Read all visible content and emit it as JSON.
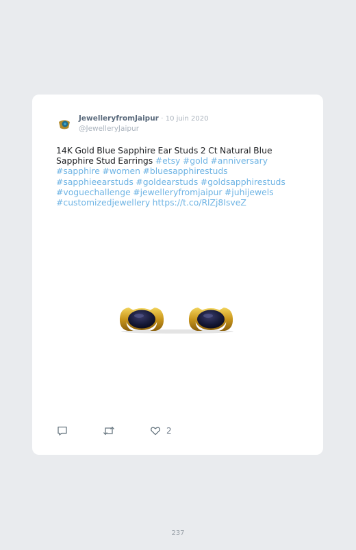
{
  "tweet": {
    "display_name": "JewelleryfromJaipur",
    "separator": "·",
    "date": "10 juin 2020",
    "handle": "@JewelleryJaipur",
    "text": "14K Gold Blue Sapphire Ear Studs 2 Ct Natural Blue Sapphire Stud Earrings",
    "hashtags": [
      "#etsy",
      "#gold",
      "#anniversary",
      "#sapphire",
      "#women",
      "#bluesapphirestuds",
      "#sapphieearstuds",
      "#goldearstuds",
      "#goldsapphirestuds",
      "#voguechallenge",
      "#jewelleryfromjaipur",
      "#juhijewels",
      "#customizedjewellery"
    ],
    "link": "https://t.co/RlZj8IsveZ",
    "like_count": "2",
    "colors": {
      "link": "#6fb4e4",
      "name": "#5b6b7d",
      "meta": "#aab3bd"
    }
  },
  "icons": {
    "avatar": "avatar-logo",
    "reply": "reply-icon",
    "retweet": "retweet-icon",
    "like": "heart-icon"
  },
  "page_number": "237"
}
